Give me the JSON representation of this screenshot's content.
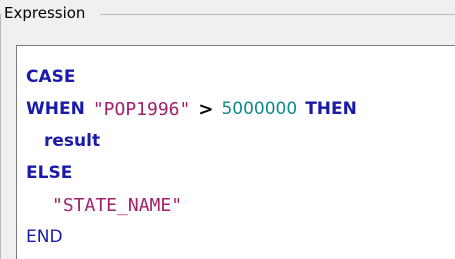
{
  "groupbox": {
    "label": "Expression"
  },
  "editor": {
    "lines": [
      {
        "kw_case": "CASE"
      },
      {
        "kw_when": "WHEN",
        "field": "\"POP1996\"",
        "operator": ">",
        "number": "5000000",
        "kw_then": "THEN"
      },
      {
        "identifier": "result"
      },
      {
        "kw_else": "ELSE"
      },
      {
        "field": "\"STATE_NAME\""
      },
      {
        "kw_end": "END"
      }
    ]
  },
  "colors": {
    "keyword": "#1a1aa8",
    "field": "#a0206a",
    "number": "#0e8a8a",
    "operator": "#000000",
    "background": "#f0f0f0",
    "editor_background": "#ffffff"
  }
}
